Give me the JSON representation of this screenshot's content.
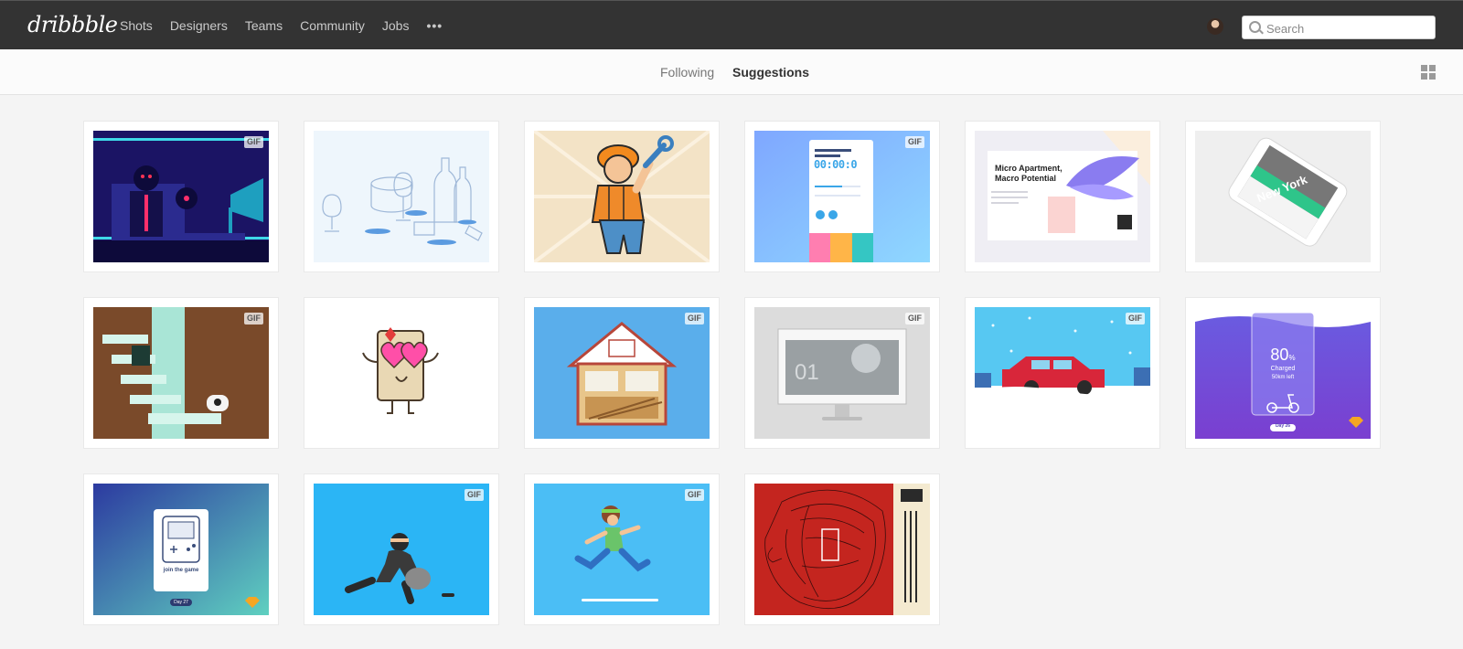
{
  "header": {
    "logo": "dribbble",
    "nav": [
      "Shots",
      "Designers",
      "Teams",
      "Community",
      "Jobs"
    ],
    "more": "•••",
    "search_placeholder": "Search"
  },
  "subnav": {
    "tabs": [
      "Following",
      "Suggestions"
    ],
    "active_tab": "Suggestions"
  },
  "shots": {
    "gif_label": "GIF",
    "micro_title": "Micro Apartment, Macro Potential",
    "timer": "00:00:0",
    "new_york": "New York",
    "monitor_number": "01",
    "charge_value": "80",
    "charge_unit": "%",
    "charge_label": "Charged",
    "charge_sub": "50km left",
    "day_26": "Day 26",
    "join_game": "join the game",
    "day_27": "Day 27"
  },
  "colors": {
    "topbar": "#333333",
    "accent_pink": "#ea4c89"
  }
}
